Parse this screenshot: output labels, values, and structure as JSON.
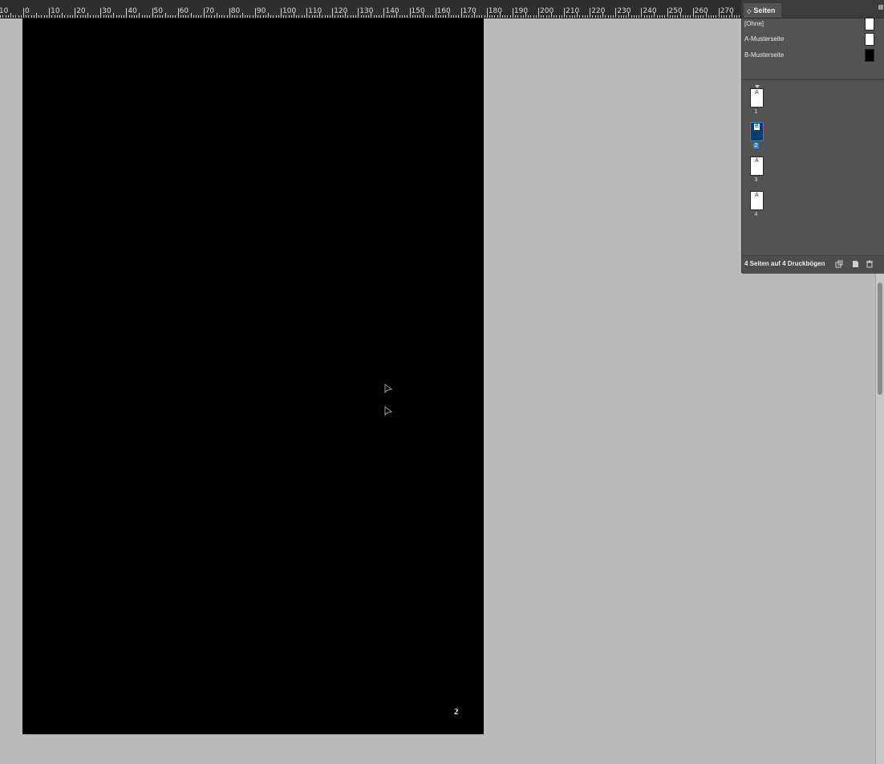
{
  "ruler": {
    "labels": [
      "10",
      "0",
      "10",
      "20",
      "30",
      "40",
      "50",
      "60",
      "70",
      "80",
      "90",
      "100",
      "110",
      "120",
      "130",
      "140",
      "150",
      "160",
      "170",
      "180",
      "190",
      "200",
      "210",
      "220",
      "230",
      "240",
      "250",
      "260",
      "270"
    ]
  },
  "document": {
    "page_number": "2",
    "page_color": "#000000",
    "pasteboard_color": "#bababa"
  },
  "pages_panel": {
    "tab_label": "Seiten",
    "collapse_icon": "◇",
    "masters": [
      {
        "label": "[Ohne]",
        "thumb_color": "#ffffff"
      },
      {
        "label": "A-Musterseite",
        "thumb_color": "#ffffff"
      },
      {
        "label": "B-Musterseite",
        "thumb_color": "#000000"
      }
    ],
    "pages": [
      {
        "master": "A",
        "number": "1",
        "selected": false
      },
      {
        "master": "B",
        "number": "2",
        "selected": true
      },
      {
        "master": "A",
        "number": "3",
        "selected": false
      },
      {
        "master": "A",
        "number": "4",
        "selected": false
      }
    ],
    "footer_text": "4 Seiten auf 4 Druckbögen",
    "footer_icons": [
      "page-size-icon",
      "new-page-icon",
      "trash-icon"
    ],
    "selection_color": "#2f86d8"
  }
}
